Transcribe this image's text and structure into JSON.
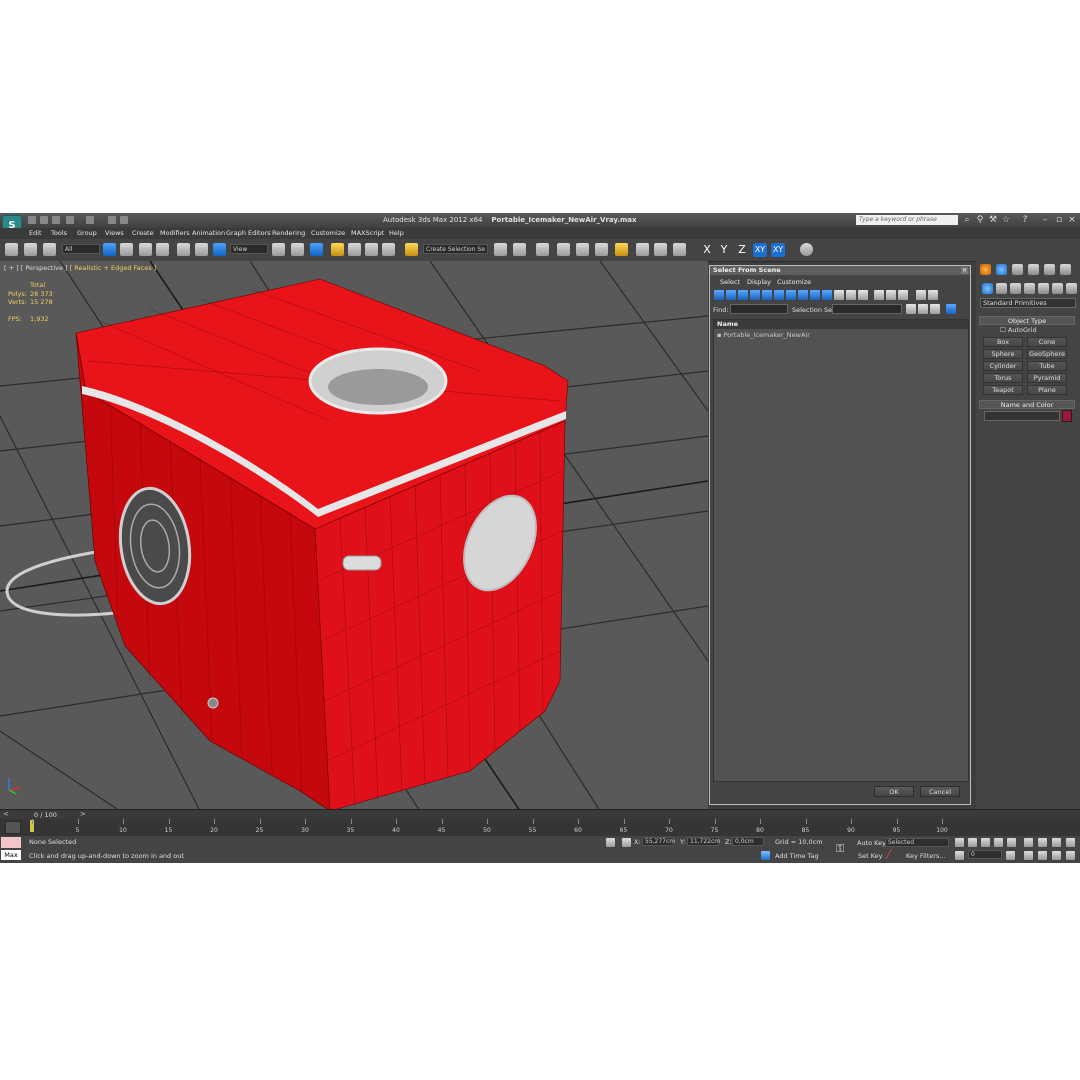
{
  "window": {
    "logo": "S",
    "title_prefix": "Autodesk 3ds Max  2012 x64",
    "filename": "Portable_Icemaker_NewAir_Vray.max",
    "search_placeholder": "Type a keyword or phrase"
  },
  "menu": [
    "Edit",
    "Tools",
    "Group",
    "Views",
    "Create",
    "Modifiers",
    "Animation",
    "Graph Editors",
    "Rendering",
    "Customize",
    "MAXScript",
    "Help"
  ],
  "toolbar": {
    "filter_value": "All",
    "reference_coord": "View",
    "named_selection": "Create Selection Se",
    "axis_x": "X",
    "axis_y": "Y",
    "axis_z": "Z",
    "axis_xy": "XY",
    "axis_xy2": "XY"
  },
  "viewport": {
    "label_plus": "[ + ]",
    "label_view": "[ Perspective ]",
    "label_shading": "[ Realistic + Edged Faces ]",
    "stats_header": "Total",
    "polys_label": "Polys:",
    "polys_value": "28 373",
    "verts_label": "Verts:",
    "verts_value": "15 278",
    "fps_label": "FPS:",
    "fps_value": "1,932",
    "model_color": "#e8141a"
  },
  "dialog": {
    "title": "Select From Scene",
    "menu": [
      "Select",
      "Display",
      "Customize"
    ],
    "find_label": "Find:",
    "selection_set_label": "Selection Set:",
    "column_name": "Name",
    "rows": [
      "Portable_Icemaker_NewAir"
    ],
    "ok_label": "OK",
    "cancel_label": "Cancel"
  },
  "command_panel": {
    "category": "Standard Primitives",
    "object_type_title": "Object Type",
    "autogrid_label": "AutoGrid",
    "primitives": [
      "Box",
      "Cone",
      "Sphere",
      "GeoSphere",
      "Cylinder",
      "Tube",
      "Torus",
      "Pyramid",
      "Teapot",
      "Plane"
    ],
    "name_color_title": "Name and Color",
    "object_color": "#a0163b"
  },
  "timeline": {
    "frame_label": "0 / 100",
    "ticks": [
      "0",
      "5",
      "10",
      "15",
      "20",
      "25",
      "30",
      "35",
      "40",
      "45",
      "50",
      "55",
      "60",
      "65",
      "70",
      "75",
      "80",
      "85",
      "90",
      "95",
      "100"
    ]
  },
  "status": {
    "maxscript_label": "Max",
    "selection_text": "None Selected",
    "prompt_text": "Click and drag up-and-down to zoom in and out",
    "x_label": "X:",
    "x_value": "55,277cm",
    "y_label": "Y:",
    "y_value": "11,722cm",
    "z_label": "Z:",
    "z_value": "0,0cm",
    "grid_text": "Grid = 10,0cm",
    "add_time_tag": "Add Time Tag",
    "auto_key": "Auto Key",
    "set_key": "Set Key",
    "selected_value": "Selected",
    "key_filters": "Key Filters...",
    "current_frame": "0"
  }
}
